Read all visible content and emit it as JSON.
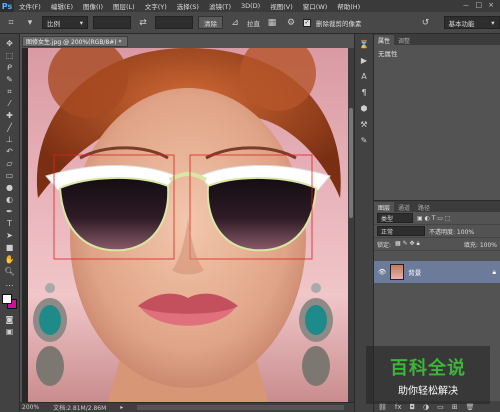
{
  "menubar": {
    "logo": "Ps",
    "items": [
      "文件(F)",
      "编辑(E)",
      "图像(I)",
      "图层(L)",
      "文字(Y)",
      "选择(S)",
      "滤镜(T)",
      "3D(D)",
      "视图(V)",
      "窗口(W)",
      "帮助(H)"
    ],
    "window_buttons": [
      "－",
      "□",
      "×"
    ]
  },
  "options": {
    "ratio_select": "比例",
    "swap_icon": "⇄",
    "clear_button": "清除",
    "straighten_label": "拉直",
    "delete_cropped_label": "删除裁剪的像素",
    "reset_icon": "↺",
    "workspace_select": "基本功能"
  },
  "document": {
    "tab_title": "图修女生.jpg @ 200%(RGB/8#) *",
    "zoom": "200%",
    "file_info": "文档:2.81M/2.86M"
  },
  "panels": {
    "properties_tabs": [
      "属性",
      "调整"
    ],
    "properties_text": "无属性",
    "layers_tabs": [
      "图层",
      "通道",
      "路径"
    ],
    "kind_select": "类型",
    "blend_mode": "正常",
    "opacity": "不透明度: 100%",
    "lock_label": "锁定:",
    "fill": "填充: 100%",
    "layer_name": "背景"
  },
  "watermark": {
    "title": "百科全说",
    "subtitle": "助你轻松解决"
  },
  "colors": {
    "foreground": "#ffffff",
    "background": "#d10f9a"
  }
}
